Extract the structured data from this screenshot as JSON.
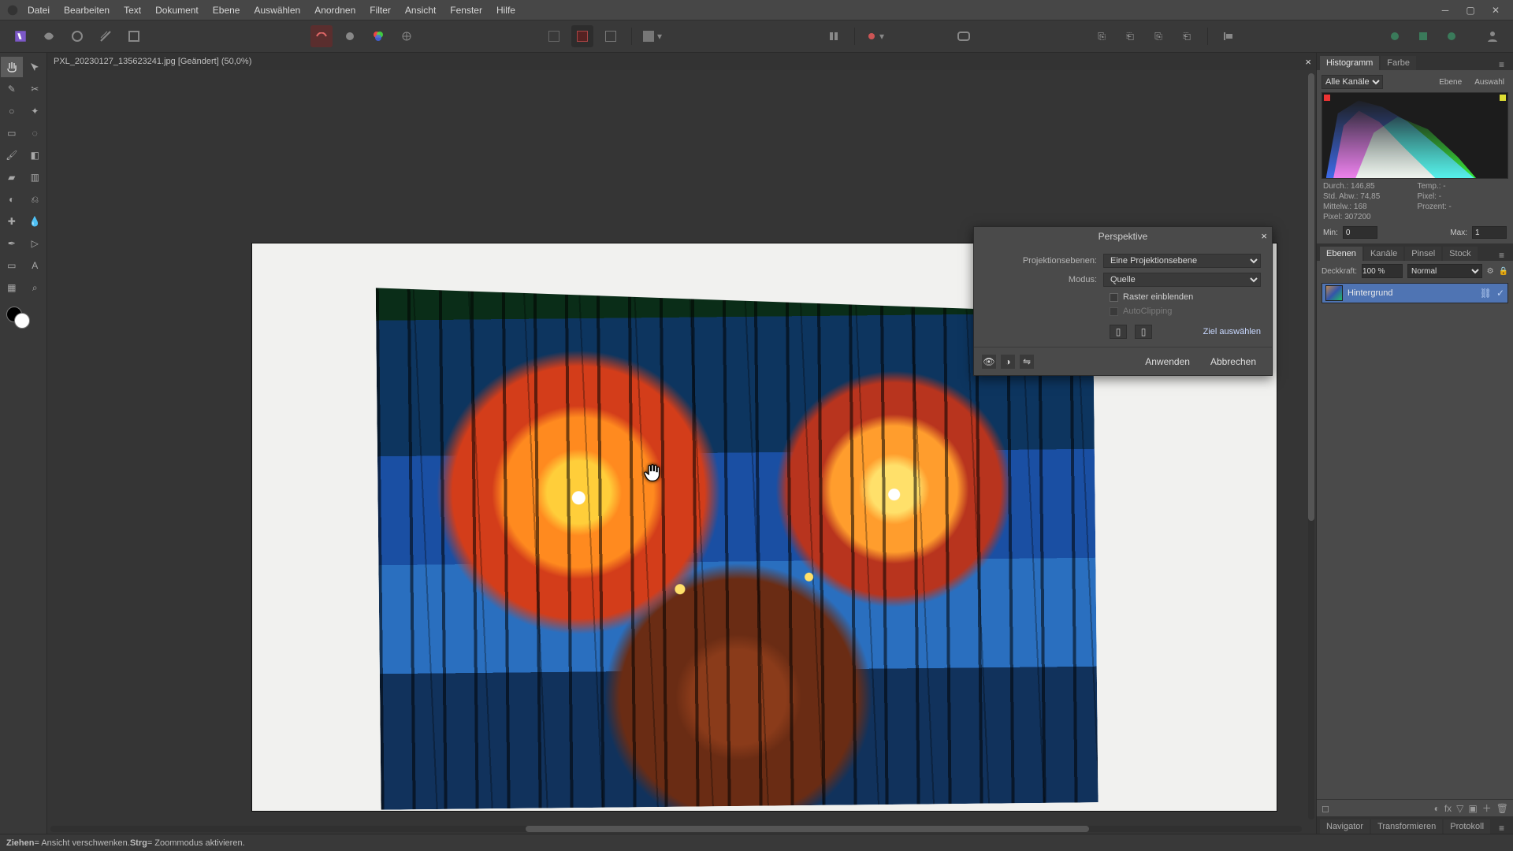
{
  "menubar": {
    "items": [
      "Datei",
      "Bearbeiten",
      "Text",
      "Dokument",
      "Ebene",
      "Auswählen",
      "Anordnen",
      "Filter",
      "Ansicht",
      "Fenster",
      "Hilfe"
    ]
  },
  "doc_tab": {
    "title": "PXL_20230127_135623241.jpg [Geändert] (50,0%)"
  },
  "dialog": {
    "title": "Perspektive",
    "rows": {
      "planes_label": "Projektionsebenen:",
      "planes_value": "Eine Projektionsebene",
      "mode_label": "Modus:",
      "mode_value": "Quelle",
      "show_grid": "Raster einblenden",
      "autoclip": "AutoClipping",
      "select_target": "Ziel auswählen"
    },
    "apply": "Anwenden",
    "cancel": "Abbrechen"
  },
  "right_tabs_top": {
    "hist": "Histogramm",
    "farbe": "Farbe"
  },
  "hist": {
    "channel_sel": "Alle Kanäle",
    "btn_ebene": "Ebene",
    "btn_auswahl": "Auswahl",
    "stats": {
      "durch": "Durch.: 146,85",
      "temp": "Temp.: -",
      "stdabw": "Std. Abw.: 74,85",
      "pixel_r": "Pixel: -",
      "mittelw": "Mittelw.: 168",
      "prozent": "Prozent: -",
      "pixel": "Pixel: 307200"
    },
    "min_label": "Min:",
    "min_val": "0",
    "max_label": "Max:",
    "max_val": "1"
  },
  "right_tabs_mid": {
    "ebenen": "Ebenen",
    "kanale": "Kanäle",
    "pinsel": "Pinsel",
    "stock": "Stock"
  },
  "layers": {
    "opacity_label": "Deckkraft:",
    "opacity_value": "100 %",
    "blend_value": "Normal",
    "layer0": "Hintergrund"
  },
  "right_tabs_bot": {
    "nav": "Navigator",
    "trans": "Transformieren",
    "prot": "Protokoll"
  },
  "status": {
    "hint_pre": "Ziehen",
    "hint_mid": " = Ansicht verschwenken. ",
    "hint_key": "Strg",
    "hint_post": " = Zoommodus aktivieren."
  },
  "colors": {
    "accent": "#4f74b3"
  }
}
